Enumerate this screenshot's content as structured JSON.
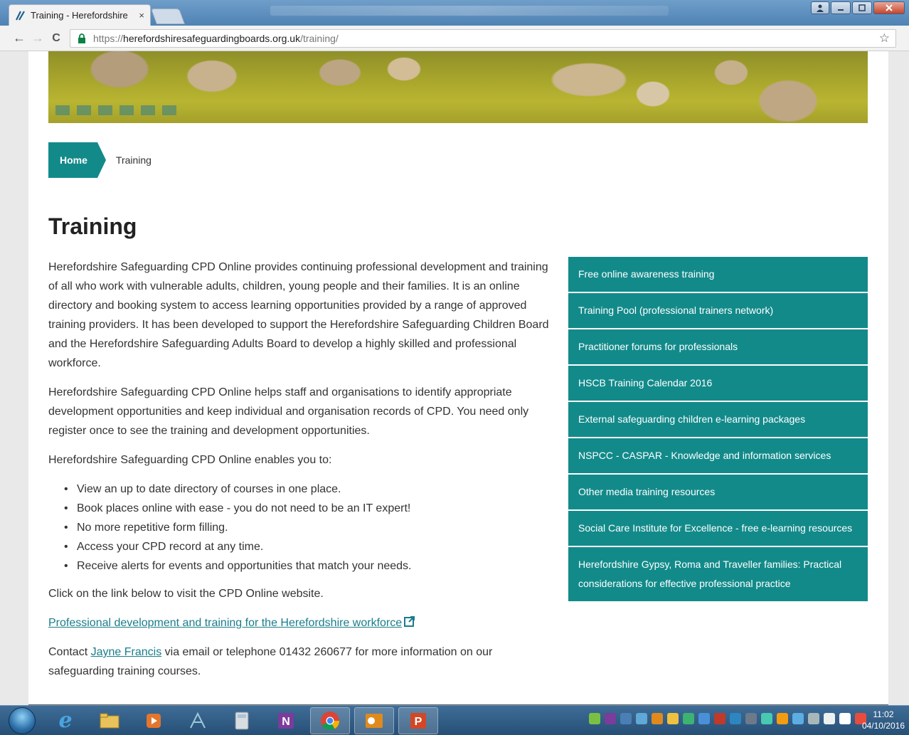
{
  "browser": {
    "tab_title": "Training - Herefordshire",
    "tab_close": "×",
    "url_prefix": "https://",
    "url_host": "herefordshiresafeguardingboards.org.uk",
    "url_path": "/training/",
    "back_icon": "←",
    "forward_icon": "→",
    "reload_icon": "C",
    "star_icon": "☆"
  },
  "breadcrumb": {
    "home": "Home",
    "current": "Training"
  },
  "page": {
    "title": "Training",
    "para1": "Herefordshire Safeguarding CPD Online provides continuing professional development and training of all who work with vulnerable adults, children, young people and their families. It is an online directory and booking system to access learning opportunities provided by a range of approved training providers. It has been developed to support the Herefordshire Safeguarding Children Board and the Herefordshire Safeguarding Adults Board to develop a highly skilled and professional workforce.",
    "para2": "Herefordshire Safeguarding CPD Online helps staff and organisations to identify appropriate development opportunities and keep individual and organisation records of CPD. You need only register once to see the training and development opportunities.",
    "para3": "Herefordshire Safeguarding CPD Online enables you to:",
    "bullets": [
      "View an up to date directory of courses in one place.",
      "Book places online with ease - you do not need to be an IT expert!",
      "No more repetitive form filling.",
      "Access your CPD record at any time.",
      "Receive alerts for events and opportunities that match your needs."
    ],
    "para4": "Click on the link below to visit the CPD Online website.",
    "cpd_link": "Professional development and training for the Herefordshire workforce",
    "contact_prefix": "Contact ",
    "contact_name": "Jayne Francis",
    "contact_suffix": " via email or telephone 01432 260677 for more information on our safeguarding training courses."
  },
  "sidebar": {
    "items": [
      "Free online awareness training",
      "Training Pool (professional trainers network)",
      "Practitioner forums for professionals",
      "HSCB Training Calendar 2016",
      "External safeguarding children e-learning packages",
      "NSPCC - CASPAR - Knowledge and information services",
      "Other media training resources",
      "Social Care Institute for Excellence - free e-learning resources",
      "Herefordshire Gypsy, Roma and Traveller families: Practical considerations for effective professional practice"
    ]
  },
  "taskbar": {
    "time": "11:02",
    "date": "04/10/2016",
    "apps": [
      "internet-explorer",
      "file-explorer",
      "media-player",
      "snipping-tool",
      "calculator",
      "onenote",
      "chrome",
      "outlook",
      "powerpoint"
    ]
  },
  "colors": {
    "accent": "#138a8a",
    "link": "#1a7d8a"
  }
}
